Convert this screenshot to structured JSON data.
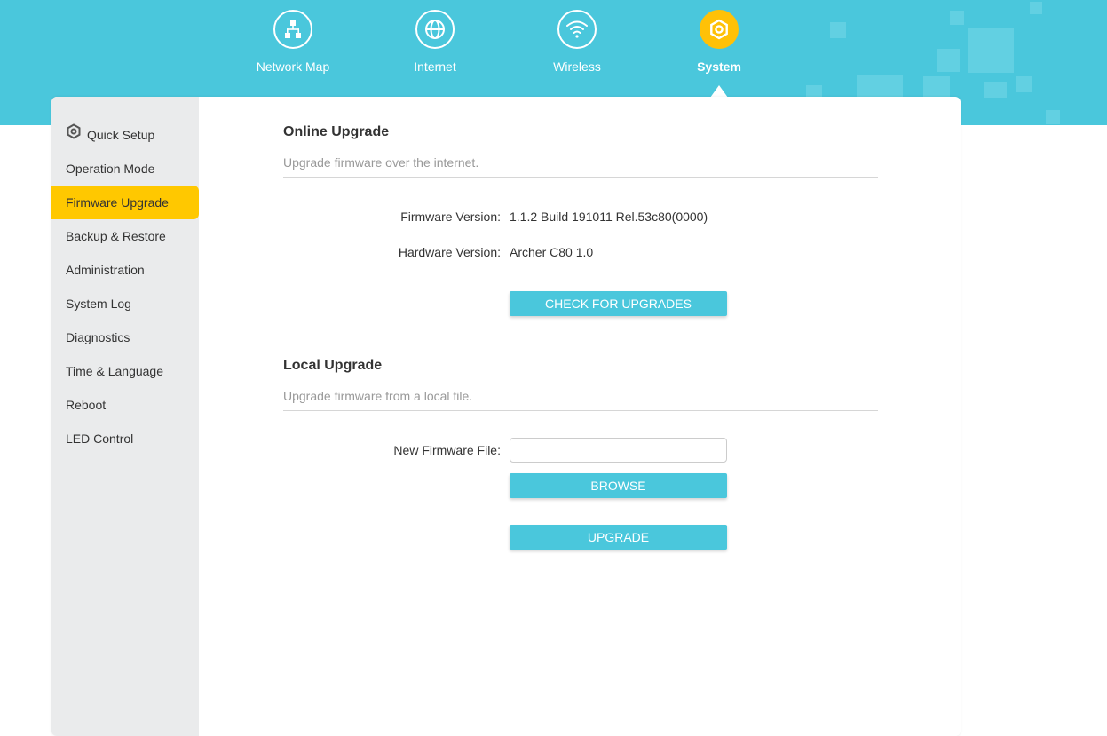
{
  "nav": {
    "items": [
      {
        "label": "Network Map",
        "icon": "network-map-icon"
      },
      {
        "label": "Internet",
        "icon": "globe-icon"
      },
      {
        "label": "Wireless",
        "icon": "wifi-icon"
      },
      {
        "label": "System",
        "icon": "gear-icon",
        "active": true
      }
    ]
  },
  "sidebar": {
    "items": [
      {
        "label": "Quick Setup",
        "icon": "quick-setup-icon"
      },
      {
        "label": "Operation Mode"
      },
      {
        "label": "Firmware Upgrade",
        "active": true
      },
      {
        "label": "Backup & Restore"
      },
      {
        "label": "Administration"
      },
      {
        "label": "System Log"
      },
      {
        "label": "Diagnostics"
      },
      {
        "label": "Time & Language"
      },
      {
        "label": "Reboot"
      },
      {
        "label": "LED Control"
      }
    ]
  },
  "online": {
    "title": "Online Upgrade",
    "desc": "Upgrade firmware over the internet.",
    "firmware_label": "Firmware Version:",
    "firmware_value": "1.1.2 Build 191011 Rel.53c80(0000)",
    "hardware_label": "Hardware Version:",
    "hardware_value": "Archer C80 1.0",
    "check_button": "CHECK FOR UPGRADES"
  },
  "local": {
    "title": "Local Upgrade",
    "desc": "Upgrade firmware from a local file.",
    "file_label": "New Firmware File:",
    "file_value": "",
    "browse_button": "BROWSE",
    "upgrade_button": "UPGRADE"
  },
  "colors": {
    "accent": "#4ac7dc",
    "active": "#ffc800",
    "sidebar_bg": "#eaebec"
  }
}
